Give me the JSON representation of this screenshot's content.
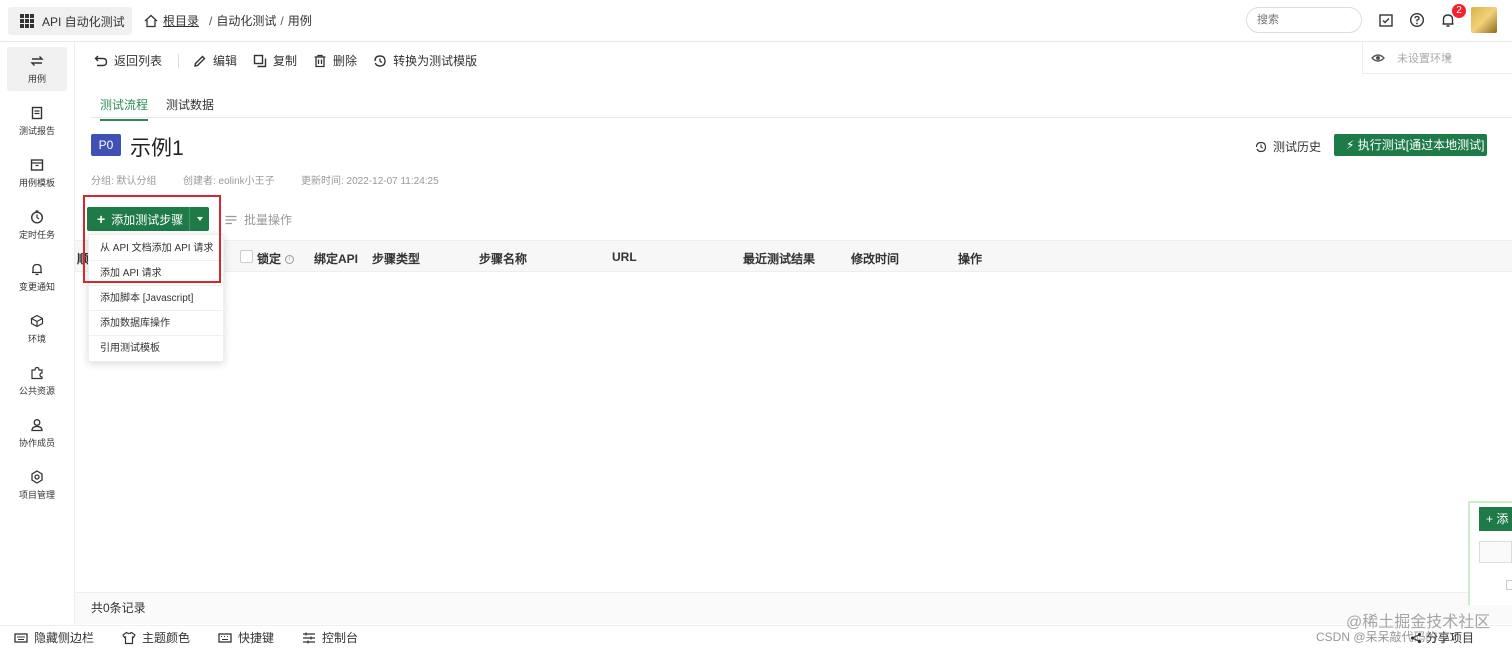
{
  "topbar": {
    "app_name": "API 自动化测试",
    "breadcrumb_root": "根目录",
    "breadcrumb_items": [
      "自动化测试",
      "用例"
    ],
    "search_placeholder": "搜索",
    "notification_count": "2"
  },
  "sidebar": {
    "items": [
      {
        "label": "用例",
        "icon": "swap-icon",
        "active": true
      },
      {
        "label": "测试报告",
        "icon": "report-icon"
      },
      {
        "label": "用例模板",
        "icon": "template-icon"
      },
      {
        "label": "定时任务",
        "icon": "clock-icon"
      },
      {
        "label": "变更通知",
        "icon": "bell-icon"
      },
      {
        "label": "环境",
        "icon": "cube-icon"
      },
      {
        "label": "公共资源",
        "icon": "puzzle-icon"
      },
      {
        "label": "协作成员",
        "icon": "user-icon"
      },
      {
        "label": "项目管理",
        "icon": "gear-icon"
      }
    ]
  },
  "toolbar": {
    "back": "返回列表",
    "edit": "编辑",
    "copy": "复制",
    "delete": "删除",
    "convert": "转换为测试模版"
  },
  "env": {
    "label": "未设置环境"
  },
  "tabs": [
    {
      "label": "测试流程",
      "active": true
    },
    {
      "label": "测试数据"
    }
  ],
  "case": {
    "priority": "P0",
    "title": "示例1",
    "group": "分组: 默认分组",
    "creator": "创建者: eolink小王子",
    "updated": "更新时间: 2022-12-07 11:24:25",
    "history": "测试历史",
    "run_button": "执行测试[通过本地测试]"
  },
  "steps": {
    "add_button": "添加测试步骤",
    "batch": "批量操作",
    "headers": [
      "锁定",
      "绑定API",
      "步骤类型",
      "步骤名称",
      "URL",
      "最近测试结果",
      "修改时间",
      "操作"
    ],
    "first_header_fragment": "顺",
    "dropdown": [
      "从 API 文档添加 API 请求",
      "添加 API 请求",
      "添加脚本 [Javascript]",
      "添加数据库操作",
      "引用测试模板"
    ],
    "total": "共0条记录"
  },
  "float_panel": {
    "add_label": "+ 添"
  },
  "bottombar": {
    "items": [
      "隐藏侧边栏",
      "主题颜色",
      "快捷键",
      "控制台"
    ]
  },
  "watermark": {
    "line1": "@稀土掘金技术社区",
    "line2": "CSDN @呆呆敲代码的小Y",
    "share": "分享项目"
  },
  "colors": {
    "primary": "#1e7a47",
    "priority_badge": "#3f51b5",
    "highlight_border": "#d9262c"
  }
}
